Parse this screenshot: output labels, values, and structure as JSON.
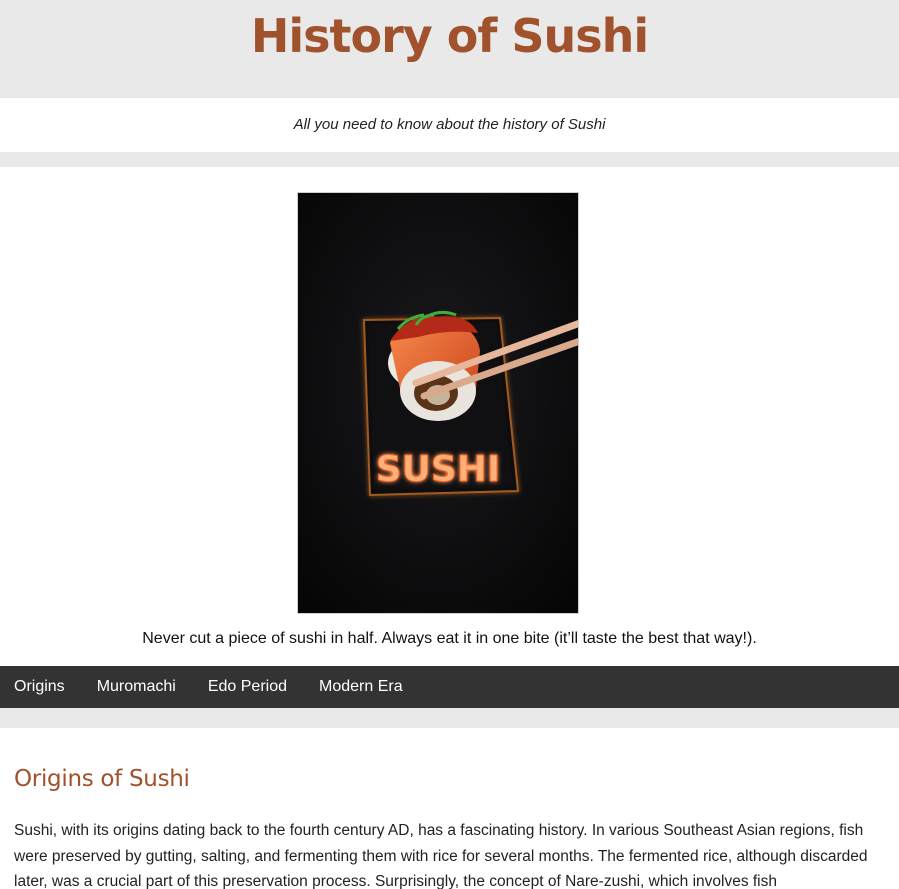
{
  "header": {
    "title": "History of Sushi"
  },
  "tagline": "All you need to know about the history of Sushi",
  "hero": {
    "image_text": "SUSHI",
    "caption": "Never cut a piece of sushi in half. Always eat it in one bite (it’ll taste the best that way!)."
  },
  "nav": {
    "items": [
      {
        "label": "Origins"
      },
      {
        "label": "Muromachi"
      },
      {
        "label": "Edo Period"
      },
      {
        "label": "Modern Era"
      }
    ]
  },
  "section": {
    "heading": "Origins of Sushi",
    "paragraph": "Sushi, with its origins dating back to the fourth century AD, has a fascinating history. In various Southeast Asian regions, fish were preserved by gutting, salting, and fermenting them with rice for several months. The fermented rice, although discarded later, was a crucial part of this preservation process. Surprisingly, the concept of Nare-zushi, which involves fish"
  },
  "colors": {
    "accent": "#a0522d",
    "nav_bg": "#333333",
    "page_bg": "#e9e9ea"
  }
}
